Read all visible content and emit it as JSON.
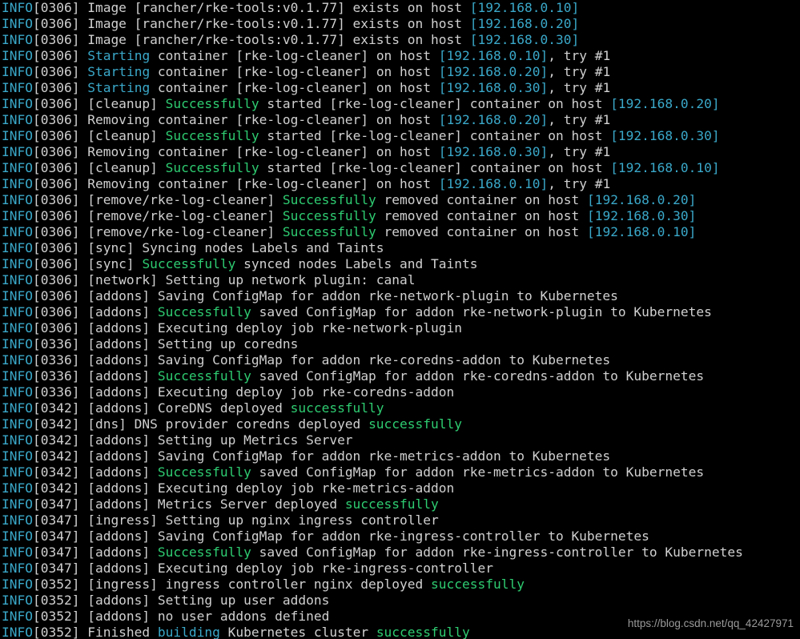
{
  "colors": {
    "background": "#000000",
    "default": "#d0d0d0",
    "info": "#3aa8c9",
    "ip": "#3aa8c9",
    "success": "#2ecc71",
    "starting": "#3aa8c9",
    "building": "#3aa8c9",
    "watermark": "#9a9a9a"
  },
  "lines": [
    [
      {
        "t": "INFO",
        "c": "info"
      },
      {
        "t": "[0306] Image [rancher/rke-tools:v0.1.77] exists on host "
      },
      {
        "t": "[192.168.0.10]",
        "c": "ip"
      }
    ],
    [
      {
        "t": "INFO",
        "c": "info"
      },
      {
        "t": "[0306] Image [rancher/rke-tools:v0.1.77] exists on host "
      },
      {
        "t": "[192.168.0.20]",
        "c": "ip"
      }
    ],
    [
      {
        "t": "INFO",
        "c": "info"
      },
      {
        "t": "[0306] Image [rancher/rke-tools:v0.1.77] exists on host "
      },
      {
        "t": "[192.168.0.30]",
        "c": "ip"
      }
    ],
    [
      {
        "t": "INFO",
        "c": "info"
      },
      {
        "t": "[0306] "
      },
      {
        "t": "Starting",
        "c": "starting"
      },
      {
        "t": " container [rke-log-cleaner] on host "
      },
      {
        "t": "[192.168.0.10]",
        "c": "ip"
      },
      {
        "t": ", try #1"
      }
    ],
    [
      {
        "t": "INFO",
        "c": "info"
      },
      {
        "t": "[0306] "
      },
      {
        "t": "Starting",
        "c": "starting"
      },
      {
        "t": " container [rke-log-cleaner] on host "
      },
      {
        "t": "[192.168.0.20]",
        "c": "ip"
      },
      {
        "t": ", try #1"
      }
    ],
    [
      {
        "t": "INFO",
        "c": "info"
      },
      {
        "t": "[0306] "
      },
      {
        "t": "Starting",
        "c": "starting"
      },
      {
        "t": " container [rke-log-cleaner] on host "
      },
      {
        "t": "[192.168.0.30]",
        "c": "ip"
      },
      {
        "t": ", try #1"
      }
    ],
    [
      {
        "t": "INFO",
        "c": "info"
      },
      {
        "t": "[0306] [cleanup] "
      },
      {
        "t": "Successfully",
        "c": "success"
      },
      {
        "t": " started [rke-log-cleaner] container on host "
      },
      {
        "t": "[192.168.0.20]",
        "c": "ip"
      }
    ],
    [
      {
        "t": "INFO",
        "c": "info"
      },
      {
        "t": "[0306] Removing container [rke-log-cleaner] on host "
      },
      {
        "t": "[192.168.0.20]",
        "c": "ip"
      },
      {
        "t": ", try #1"
      }
    ],
    [
      {
        "t": "INFO",
        "c": "info"
      },
      {
        "t": "[0306] [cleanup] "
      },
      {
        "t": "Successfully",
        "c": "success"
      },
      {
        "t": " started [rke-log-cleaner] container on host "
      },
      {
        "t": "[192.168.0.30]",
        "c": "ip"
      }
    ],
    [
      {
        "t": "INFO",
        "c": "info"
      },
      {
        "t": "[0306] Removing container [rke-log-cleaner] on host "
      },
      {
        "t": "[192.168.0.30]",
        "c": "ip"
      },
      {
        "t": ", try #1"
      }
    ],
    [
      {
        "t": "INFO",
        "c": "info"
      },
      {
        "t": "[0306] [cleanup] "
      },
      {
        "t": "Successfully",
        "c": "success"
      },
      {
        "t": " started [rke-log-cleaner] container on host "
      },
      {
        "t": "[192.168.0.10]",
        "c": "ip"
      }
    ],
    [
      {
        "t": "INFO",
        "c": "info"
      },
      {
        "t": "[0306] Removing container [rke-log-cleaner] on host "
      },
      {
        "t": "[192.168.0.10]",
        "c": "ip"
      },
      {
        "t": ", try #1"
      }
    ],
    [
      {
        "t": "INFO",
        "c": "info"
      },
      {
        "t": "[0306] [remove/rke-log-cleaner] "
      },
      {
        "t": "Successfully",
        "c": "success"
      },
      {
        "t": " removed container on host "
      },
      {
        "t": "[192.168.0.20]",
        "c": "ip"
      }
    ],
    [
      {
        "t": "INFO",
        "c": "info"
      },
      {
        "t": "[0306] [remove/rke-log-cleaner] "
      },
      {
        "t": "Successfully",
        "c": "success"
      },
      {
        "t": " removed container on host "
      },
      {
        "t": "[192.168.0.30]",
        "c": "ip"
      }
    ],
    [
      {
        "t": "INFO",
        "c": "info"
      },
      {
        "t": "[0306] [remove/rke-log-cleaner] "
      },
      {
        "t": "Successfully",
        "c": "success"
      },
      {
        "t": " removed container on host "
      },
      {
        "t": "[192.168.0.10]",
        "c": "ip"
      }
    ],
    [
      {
        "t": "INFO",
        "c": "info"
      },
      {
        "t": "[0306] [sync] Syncing nodes Labels and Taints"
      }
    ],
    [
      {
        "t": "INFO",
        "c": "info"
      },
      {
        "t": "[0306] [sync] "
      },
      {
        "t": "Successfully",
        "c": "success"
      },
      {
        "t": " synced nodes Labels and Taints"
      }
    ],
    [
      {
        "t": "INFO",
        "c": "info"
      },
      {
        "t": "[0306] [network] Setting up network plugin: canal"
      }
    ],
    [
      {
        "t": "INFO",
        "c": "info"
      },
      {
        "t": "[0306] [addons] Saving ConfigMap for addon rke-network-plugin to Kubernetes"
      }
    ],
    [
      {
        "t": "INFO",
        "c": "info"
      },
      {
        "t": "[0306] [addons] "
      },
      {
        "t": "Successfully",
        "c": "success"
      },
      {
        "t": " saved ConfigMap for addon rke-network-plugin to Kubernetes"
      }
    ],
    [
      {
        "t": "INFO",
        "c": "info"
      },
      {
        "t": "[0306] [addons] Executing deploy job rke-network-plugin"
      }
    ],
    [
      {
        "t": "INFO",
        "c": "info"
      },
      {
        "t": "[0336] [addons] Setting up coredns"
      }
    ],
    [
      {
        "t": "INFO",
        "c": "info"
      },
      {
        "t": "[0336] [addons] Saving ConfigMap for addon rke-coredns-addon to Kubernetes"
      }
    ],
    [
      {
        "t": "INFO",
        "c": "info"
      },
      {
        "t": "[0336] [addons] "
      },
      {
        "t": "Successfully",
        "c": "success"
      },
      {
        "t": " saved ConfigMap for addon rke-coredns-addon to Kubernetes"
      }
    ],
    [
      {
        "t": "INFO",
        "c": "info"
      },
      {
        "t": "[0336] [addons] Executing deploy job rke-coredns-addon"
      }
    ],
    [
      {
        "t": "INFO",
        "c": "info"
      },
      {
        "t": "[0342] [addons] CoreDNS deployed "
      },
      {
        "t": "successfully",
        "c": "success"
      }
    ],
    [
      {
        "t": "INFO",
        "c": "info"
      },
      {
        "t": "[0342] [dns] DNS provider coredns deployed "
      },
      {
        "t": "successfully",
        "c": "success"
      }
    ],
    [
      {
        "t": "INFO",
        "c": "info"
      },
      {
        "t": "[0342] [addons] Setting up Metrics Server"
      }
    ],
    [
      {
        "t": "INFO",
        "c": "info"
      },
      {
        "t": "[0342] [addons] Saving ConfigMap for addon rke-metrics-addon to Kubernetes"
      }
    ],
    [
      {
        "t": "INFO",
        "c": "info"
      },
      {
        "t": "[0342] [addons] "
      },
      {
        "t": "Successfully",
        "c": "success"
      },
      {
        "t": " saved ConfigMap for addon rke-metrics-addon to Kubernetes"
      }
    ],
    [
      {
        "t": "INFO",
        "c": "info"
      },
      {
        "t": "[0342] [addons] Executing deploy job rke-metrics-addon"
      }
    ],
    [
      {
        "t": "INFO",
        "c": "info"
      },
      {
        "t": "[0347] [addons] Metrics Server deployed "
      },
      {
        "t": "successfully",
        "c": "success"
      }
    ],
    [
      {
        "t": "INFO",
        "c": "info"
      },
      {
        "t": "[0347] [ingress] Setting up nginx ingress controller"
      }
    ],
    [
      {
        "t": "INFO",
        "c": "info"
      },
      {
        "t": "[0347] [addons] Saving ConfigMap for addon rke-ingress-controller to Kubernetes"
      }
    ],
    [
      {
        "t": "INFO",
        "c": "info"
      },
      {
        "t": "[0347] [addons] "
      },
      {
        "t": "Successfully",
        "c": "success"
      },
      {
        "t": " saved ConfigMap for addon rke-ingress-controller to Kubernetes"
      }
    ],
    [
      {
        "t": "INFO",
        "c": "info"
      },
      {
        "t": "[0347] [addons] Executing deploy job rke-ingress-controller"
      }
    ],
    [
      {
        "t": "INFO",
        "c": "info"
      },
      {
        "t": "[0352] [ingress] ingress controller nginx deployed "
      },
      {
        "t": "successfully",
        "c": "success"
      }
    ],
    [
      {
        "t": "INFO",
        "c": "info"
      },
      {
        "t": "[0352] [addons] Setting up user addons"
      }
    ],
    [
      {
        "t": "INFO",
        "c": "info"
      },
      {
        "t": "[0352] [addons] no user addons defined"
      }
    ],
    [
      {
        "t": "INFO",
        "c": "info"
      },
      {
        "t": "[0352] Finished "
      },
      {
        "t": "building",
        "c": "building"
      },
      {
        "t": " Kubernetes cluster "
      },
      {
        "t": "successfully",
        "c": "success"
      }
    ]
  ],
  "watermark": "https://blog.csdn.net/qq_42427971"
}
